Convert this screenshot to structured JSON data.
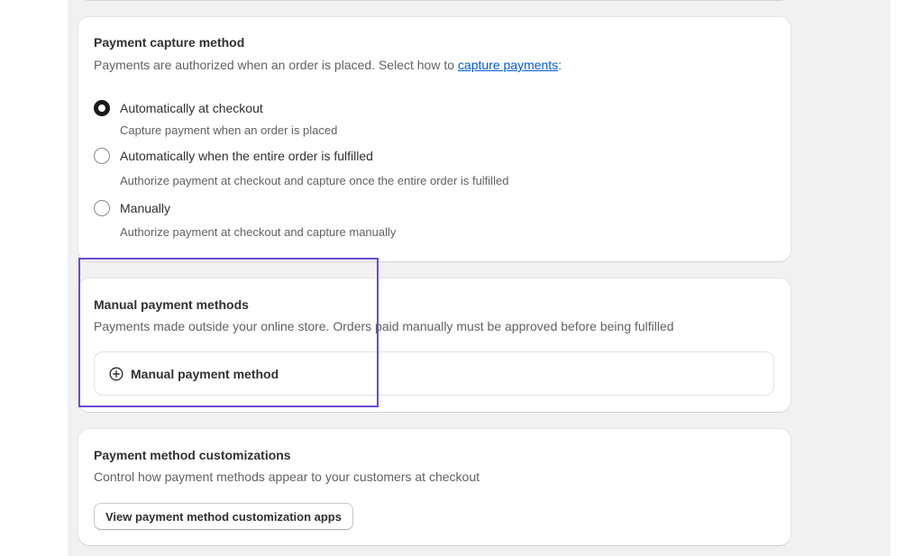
{
  "capture_section": {
    "title": "Payment capture method",
    "description_prefix": "Payments are authorized when an order is placed. Select how to ",
    "description_link": "capture payments",
    "description_suffix": ":",
    "options": [
      {
        "label": "Automatically at checkout",
        "help": "Capture payment when an order is placed",
        "checked": true
      },
      {
        "label": "Automatically when the entire order is fulfilled",
        "help": "Authorize payment at checkout and capture once the entire order is fulfilled",
        "checked": false
      },
      {
        "label": "Manually",
        "help": "Authorize payment at checkout and capture manually",
        "checked": false
      }
    ]
  },
  "manual_section": {
    "title": "Manual payment methods",
    "description": "Payments made outside your online store. Orders paid manually must be approved before being fulfilled",
    "add_label": "Manual payment method",
    "add_icon": "plus-circle-icon"
  },
  "custom_section": {
    "title": "Payment method customizations",
    "description": "Control how payment methods appear to your customers at checkout",
    "button_label": "View payment method customization apps"
  },
  "colors": {
    "link": "#005bd3",
    "highlight": "#6a4bd1",
    "page_bg": "#f1f1f1"
  }
}
